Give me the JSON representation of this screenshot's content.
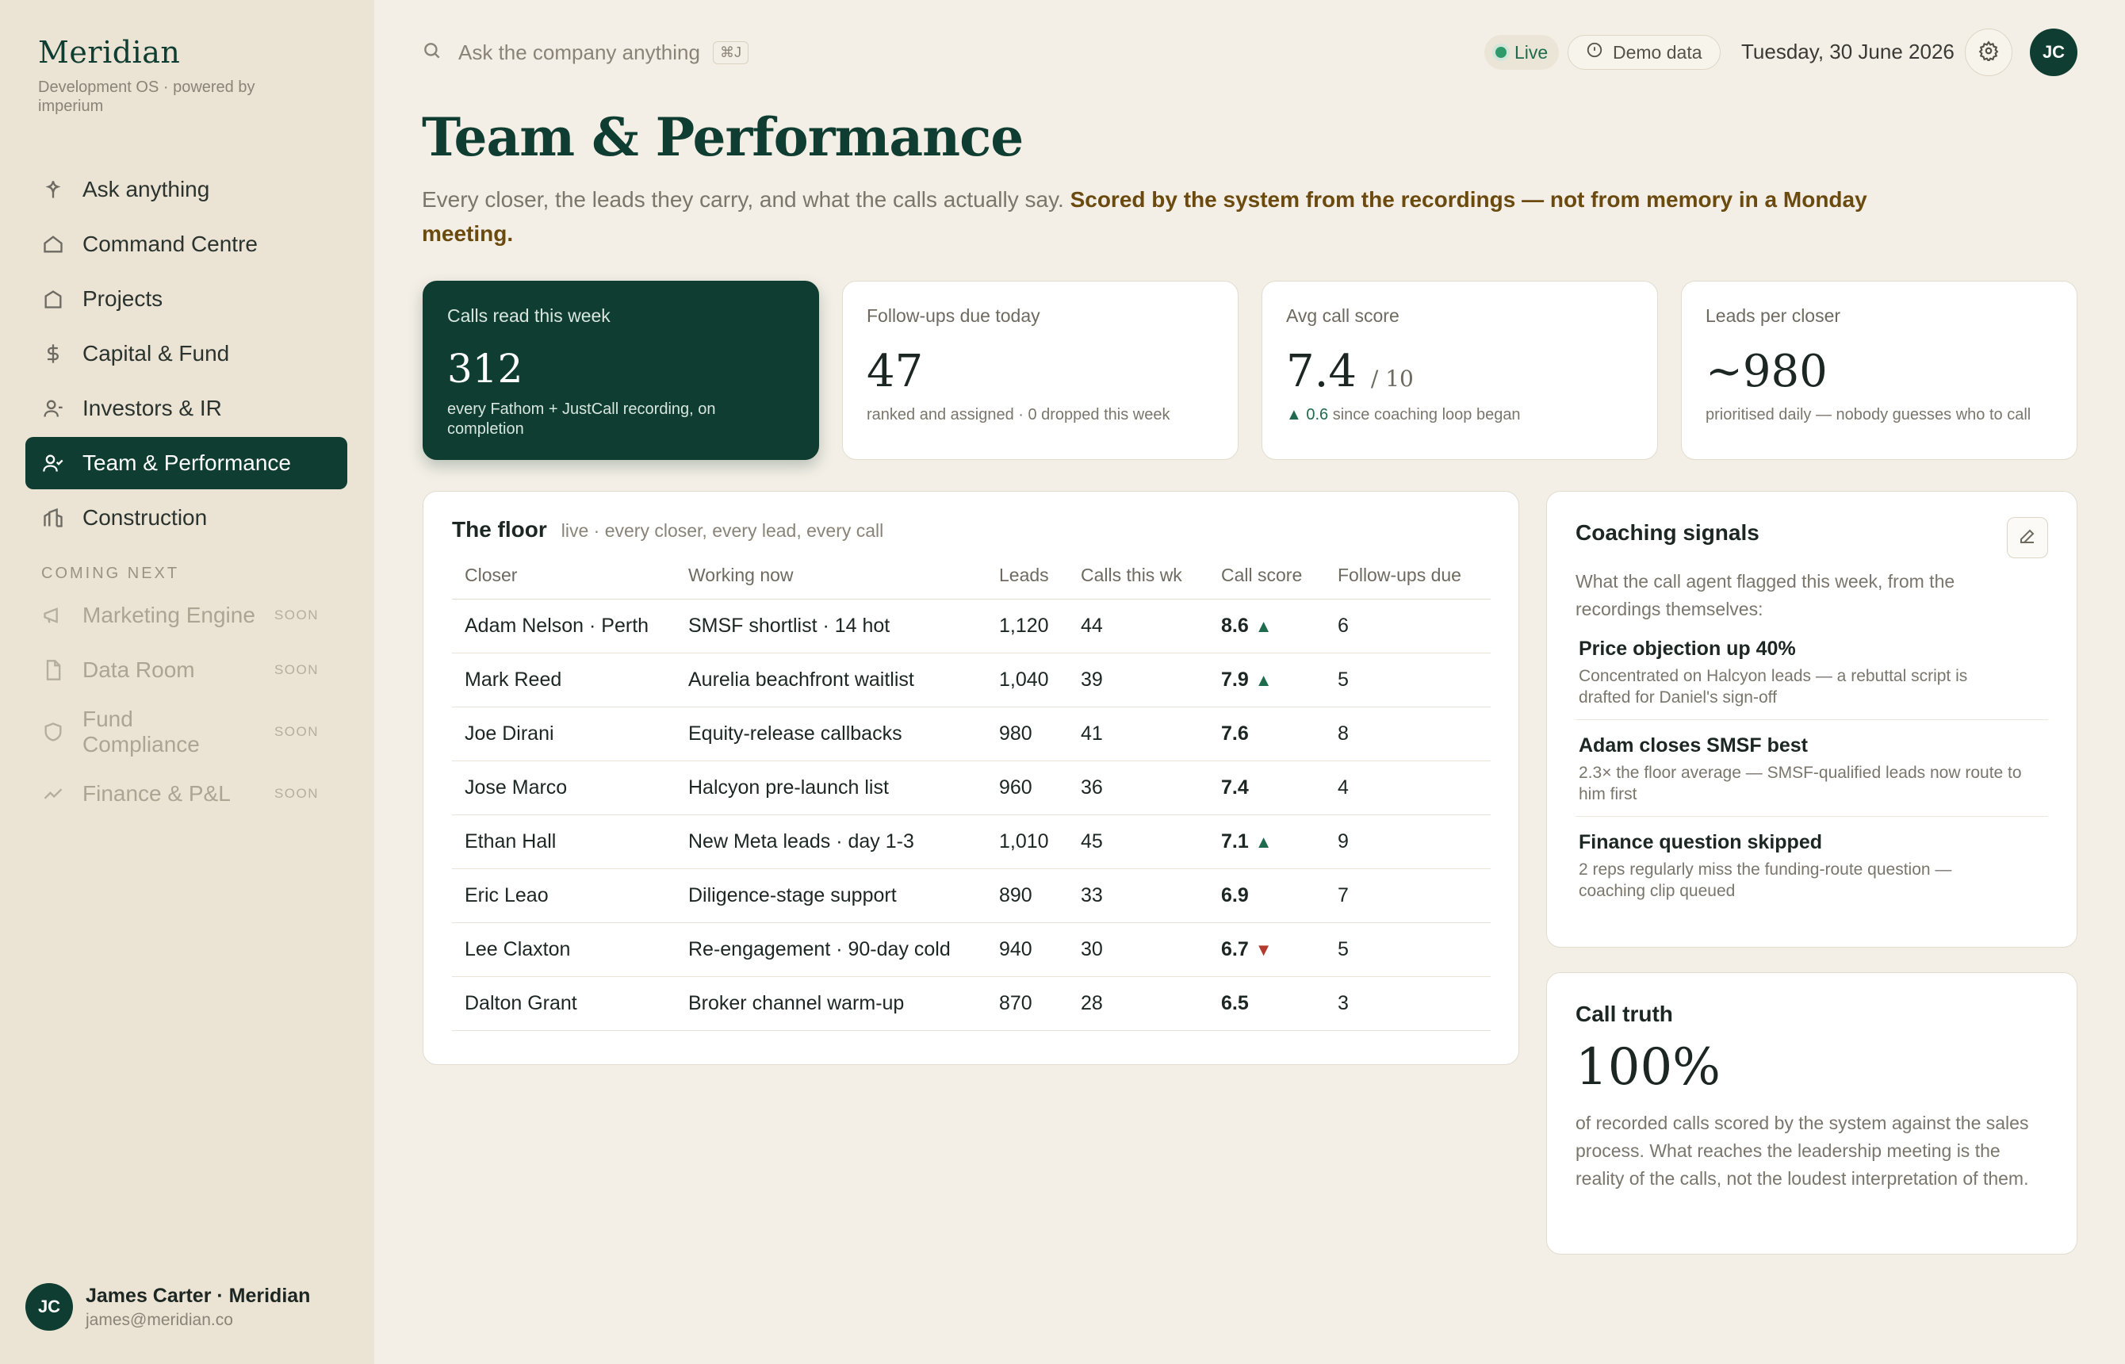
{
  "brand": {
    "name": "Meridian",
    "subtitle": "Development OS · powered by imperium"
  },
  "nav": {
    "items": [
      {
        "label": "Ask anything",
        "icon": "sparkle-icon"
      },
      {
        "label": "Command Centre",
        "icon": "home-icon"
      },
      {
        "label": "Projects",
        "icon": "building-icon"
      },
      {
        "label": "Capital & Fund",
        "icon": "dollar-icon"
      },
      {
        "label": "Investors & IR",
        "icon": "investors-icon"
      },
      {
        "label": "Team & Performance",
        "icon": "team-icon",
        "active": true
      },
      {
        "label": "Construction",
        "icon": "construction-icon"
      }
    ],
    "section_label": "COMING NEXT",
    "soon_items": [
      {
        "label": "Marketing Engine",
        "tag": "SOON",
        "icon": "megaphone-icon"
      },
      {
        "label": "Data Room",
        "tag": "SOON",
        "icon": "file-icon"
      },
      {
        "label": "Fund Compliance",
        "tag": "SOON",
        "icon": "shield-icon"
      },
      {
        "label": "Finance & P&L",
        "tag": "SOON",
        "icon": "trend-icon"
      }
    ]
  },
  "user": {
    "initials": "JC",
    "name": "James Carter · Meridian",
    "email": "james@meridian.co"
  },
  "topbar": {
    "search_placeholder": "Ask the company anything",
    "shortcut": "⌘J",
    "live_label": "Live",
    "demo_label": "Demo data",
    "date": "Tuesday, 30 June 2026",
    "avatar_initials": "JC"
  },
  "page": {
    "title": "Team & Performance",
    "subtitle_plain": "Every closer, the leads they carry, and what the calls actually say. ",
    "subtitle_bold": "Scored by the system from the recordings — not from memory in a Monday meeting."
  },
  "stats": [
    {
      "label": "Calls read this week",
      "value": "312",
      "note": "every Fathom + JustCall recording, on completion"
    },
    {
      "label": "Follow-ups due today",
      "value": "47",
      "note": "ranked and assigned · 0 dropped this week"
    },
    {
      "label": "Avg call score",
      "value": "7.4",
      "of": "/ 10",
      "delta": "▲ 0.6",
      "note": " since coaching loop began"
    },
    {
      "label": "Leads per closer",
      "value": "~980",
      "note": "prioritised daily — nobody guesses who to call"
    }
  ],
  "floor": {
    "title": "The floor",
    "subtitle": "live · every closer, every lead, every call",
    "columns": [
      "Closer",
      "Working now",
      "Leads",
      "Calls this wk",
      "Call score",
      "Follow-ups due"
    ],
    "rows": [
      {
        "closer": "Adam Nelson · Perth",
        "working": "SMSF shortlist · 14 hot",
        "leads": "1,120",
        "calls": "44",
        "score": "8.6",
        "trend": "up",
        "followups": "6"
      },
      {
        "closer": "Mark Reed",
        "working": "Aurelia beachfront waitlist",
        "leads": "1,040",
        "calls": "39",
        "score": "7.9",
        "trend": "up",
        "followups": "5"
      },
      {
        "closer": "Joe Dirani",
        "working": "Equity-release callbacks",
        "leads": "980",
        "calls": "41",
        "score": "7.6",
        "trend": "",
        "followups": "8"
      },
      {
        "closer": "Jose Marco",
        "working": "Halcyon pre-launch list",
        "leads": "960",
        "calls": "36",
        "score": "7.4",
        "trend": "",
        "followups": "4"
      },
      {
        "closer": "Ethan Hall",
        "working": "New Meta leads · day 1-3",
        "leads": "1,010",
        "calls": "45",
        "score": "7.1",
        "trend": "up",
        "followups": "9"
      },
      {
        "closer": "Eric Leao",
        "working": "Diligence-stage support",
        "leads": "890",
        "calls": "33",
        "score": "6.9",
        "trend": "",
        "followups": "7"
      },
      {
        "closer": "Lee Claxton",
        "working": "Re-engagement · 90-day cold",
        "leads": "940",
        "calls": "30",
        "score": "6.7",
        "trend": "down",
        "followups": "5"
      },
      {
        "closer": "Dalton Grant",
        "working": "Broker channel warm-up",
        "leads": "870",
        "calls": "28",
        "score": "6.5",
        "trend": "",
        "followups": "3"
      }
    ]
  },
  "coaching": {
    "title": "Coaching signals",
    "intro": "What the call agent flagged this week, from the recordings themselves:",
    "signals": [
      {
        "title": "Price objection up 40%",
        "body": "Concentrated on Halcyon leads — a rebuttal script is drafted for Daniel's sign-off"
      },
      {
        "title": "Adam closes SMSF best",
        "body": "2.3× the floor average — SMSF-qualified leads now route to him first"
      },
      {
        "title": "Finance question skipped",
        "body": "2 reps regularly miss the funding-route question — coaching clip queued"
      }
    ]
  },
  "truth": {
    "title": "Call truth",
    "value": "100%",
    "body": "of recorded calls scored by the system against the sales process. What reaches the leadership meeting is the reality of the calls, not the loudest interpretation of them."
  }
}
